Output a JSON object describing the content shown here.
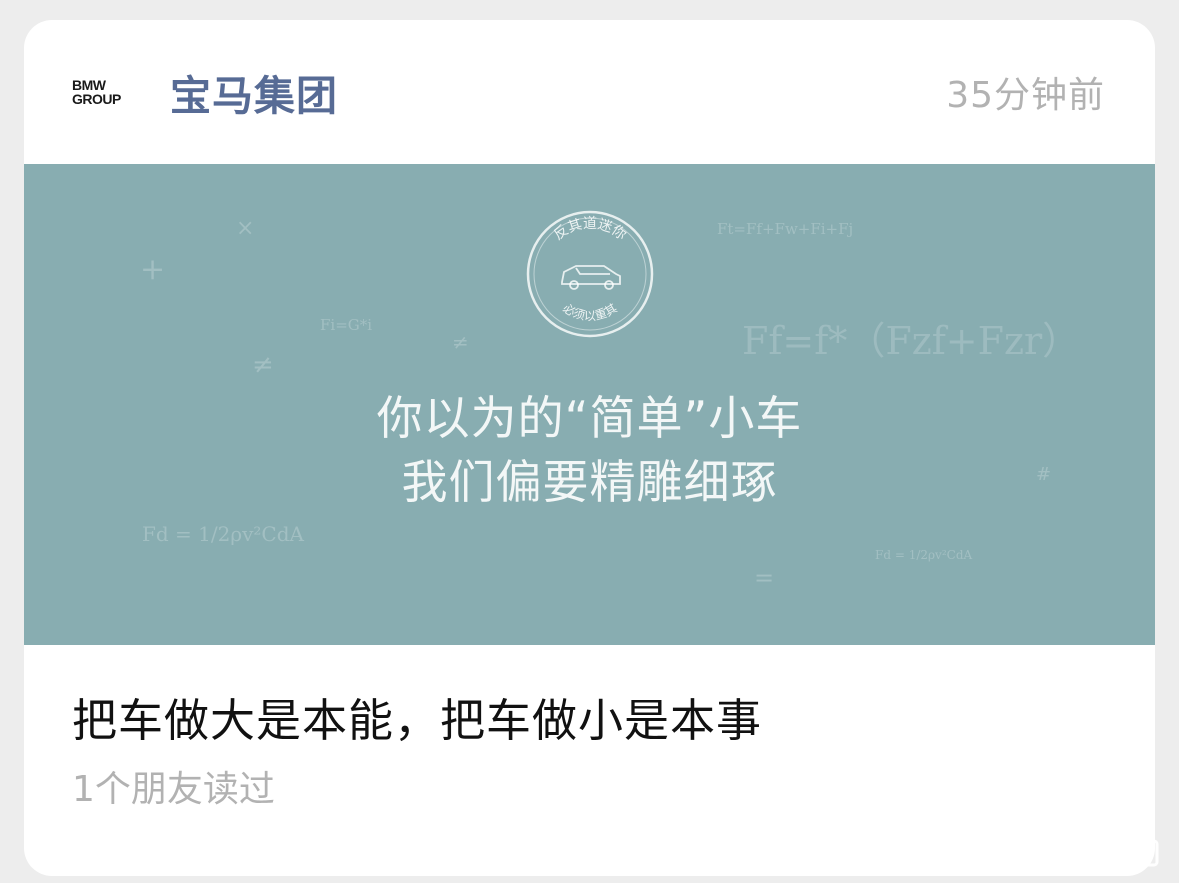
{
  "header": {
    "logo_line1": "BMW",
    "logo_line2": "GROUP",
    "account_name": "宝马集团",
    "time_ago": "35分钟前"
  },
  "cover": {
    "background_color": "#88adb1",
    "stamp_top": "反其道迷你",
    "stamp_bottom": "必须以重其",
    "headline_line1": "你以为的“简单”小车",
    "headline_line2": "我们偏要精雕细琢",
    "formulas": {
      "f1": "Ft=Ff+Fw+Fi+Fj",
      "f2": "Fi=G*i",
      "f3": "Ff=f*（Fzf+Fzr）",
      "f4": "Fd = 1/2ρv²CdA",
      "f5": "Fd = 1/2ρv²CdA",
      "sym_times": "×",
      "sym_plus": "+",
      "sym_neq1": "≠",
      "sym_neq2": "≠",
      "sym_hash": "#",
      "sym_eq": "="
    }
  },
  "article": {
    "title": "把车做大是本能，把车做小是本事",
    "read_count": "1个朋友读过"
  }
}
